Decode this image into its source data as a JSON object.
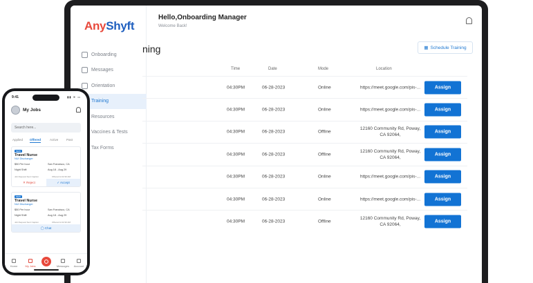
{
  "web": {
    "logo": {
      "part1": "Any",
      "part2": "Shyft"
    },
    "header": {
      "greeting": "Hello,Onboarding Manager",
      "subtitle": "Welcome Back!"
    },
    "nav": [
      {
        "label": "Onboarding",
        "icon": "onboarding-icon"
      },
      {
        "label": "Messages",
        "icon": "messages-icon"
      },
      {
        "label": "Orientation",
        "icon": "orientation-icon"
      },
      {
        "label": "Training",
        "icon": "training-icon",
        "active": true
      },
      {
        "label": "Resources",
        "icon": "resources-icon"
      },
      {
        "label": "Vaccines & Tests",
        "icon": "vaccines-icon"
      },
      {
        "label": "Tax Forms",
        "icon": "tax-forms-icon"
      }
    ],
    "page_title": "ning",
    "schedule_button": "Schedule Training",
    "columns": {
      "time": "Time",
      "date": "Date",
      "mode": "Mode",
      "location": "Location"
    },
    "rows": [
      {
        "time": "04:30PM",
        "date": "06-28-2023",
        "mode": "Online",
        "location": "https://meet.google.com/pis-...",
        "action": "Assign"
      },
      {
        "time": "04:30PM",
        "date": "06-28-2023",
        "mode": "Online",
        "location": "https://meet.google.com/pis-...",
        "action": "Assign"
      },
      {
        "time": "04:30PM",
        "date": "06-28-2023",
        "mode": "Offline",
        "location": "12160 Community Rd, Poway, CA 92064,",
        "action": "Assign"
      },
      {
        "time": "04:30PM",
        "date": "06-28-2023",
        "mode": "Offline",
        "location": "12160 Community Rd, Poway, CA 92064,",
        "action": "Assign"
      },
      {
        "time": "04:30PM",
        "date": "06-28-2023",
        "mode": "Online",
        "location": "https://meet.google.com/pis-...",
        "action": "Assign"
      },
      {
        "time": "04:30PM",
        "date": "06-28-2023",
        "mode": "Online",
        "location": "https://meet.google.com/pis-...",
        "action": "Assign"
      },
      {
        "time": "04:30PM",
        "date": "06-28-2023",
        "mode": "Offline",
        "location": "12160 Community Rd, Poway, CA 92064,",
        "action": "Assign"
      }
    ]
  },
  "mobile": {
    "time": "9:41",
    "status": "▮▮ ≋ ▭",
    "title": "My Jobs",
    "search_placeholder": "Search here...",
    "tabs": [
      "Applied",
      "Offered",
      "Active",
      "Past"
    ],
    "active_tab": "Offered",
    "cards": [
      {
        "badge": "NEW",
        "title": "Travel Nurse",
        "org": "NUI Dischanger",
        "rate": "$50 Per hour",
        "location": "San Francisco, CA",
        "shift": "Night Shift",
        "dates": "Aug 18 - Aug 29",
        "note": "Job Request Sent Caption",
        "note_right": "Offered At 02:30 AM",
        "reject": "✕  Reject",
        "accept": "✓  Accept"
      },
      {
        "badge": "NEW",
        "title": "Travel Nurse",
        "org": "NUI Dischanger",
        "rate": "$50 Per hour",
        "location": "San Francisco, CA",
        "shift": "Night Shift",
        "dates": "Aug 18 - Aug 29",
        "note": "Job Request Sent Caption",
        "note_right": "Offered At 02:30 AM",
        "chat": "◯  Chat"
      }
    ],
    "bottom_nav": [
      {
        "label": "Home",
        "icon": "home-icon"
      },
      {
        "label": "My Jobs",
        "icon": "my-jobs-icon",
        "active": true
      },
      {
        "label": "Messages",
        "icon": "messages-icon"
      },
      {
        "label": "Account",
        "icon": "account-icon"
      }
    ]
  },
  "colors": {
    "brand_red": "#e8493c",
    "brand_blue": "#1f5fbf",
    "accent": "#1273d4",
    "active_bg": "#e7f0fb"
  }
}
